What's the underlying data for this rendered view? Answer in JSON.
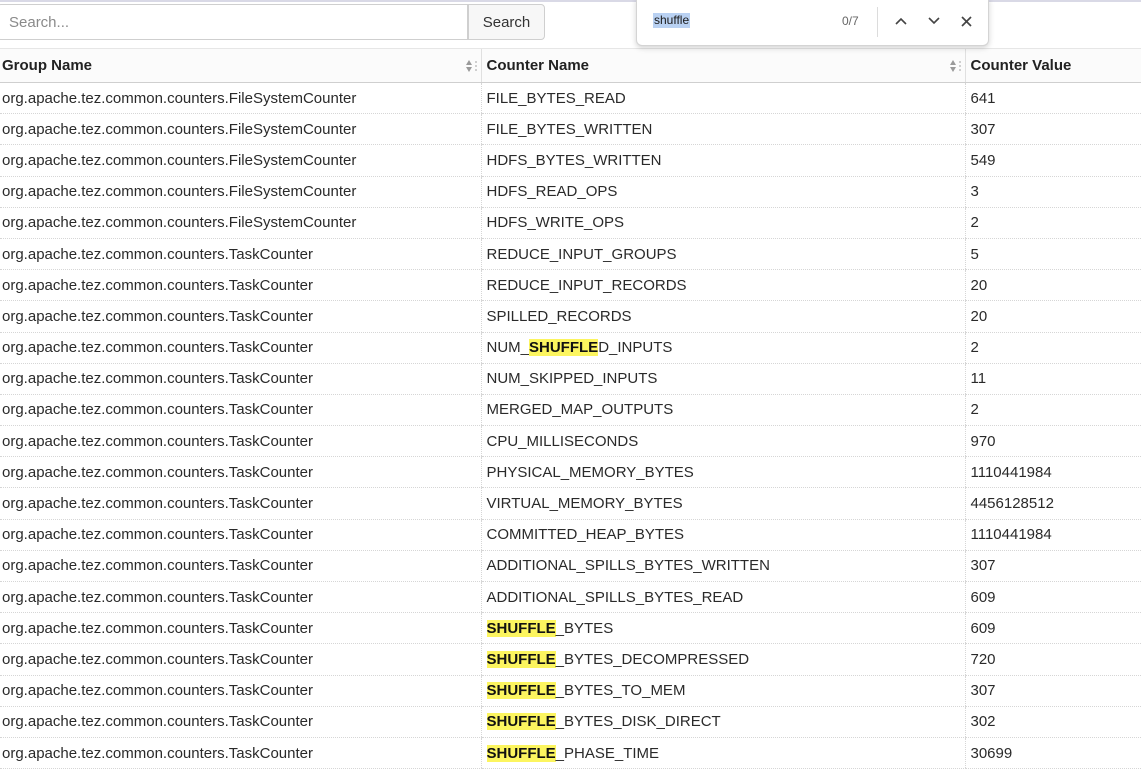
{
  "search": {
    "placeholder": "Search...",
    "value": "",
    "button_label": "Search"
  },
  "find_bar": {
    "query": "shuffle",
    "match_count": "0/7",
    "icons": [
      "chevron-up-icon",
      "chevron-down-icon",
      "close-icon"
    ]
  },
  "table": {
    "columns": [
      {
        "label": "Group Name",
        "sortable": true
      },
      {
        "label": "Counter Name",
        "sortable": true
      },
      {
        "label": "Counter Value",
        "sortable": false
      }
    ],
    "highlight_color": "#fcf55f",
    "rows": [
      {
        "group": "org.apache.tez.common.counters.FileSystemCounter",
        "name": "FILE_BYTES_READ",
        "value": "641"
      },
      {
        "group": "org.apache.tez.common.counters.FileSystemCounter",
        "name": "FILE_BYTES_WRITTEN",
        "value": "307"
      },
      {
        "group": "org.apache.tez.common.counters.FileSystemCounter",
        "name": "HDFS_BYTES_WRITTEN",
        "value": "549"
      },
      {
        "group": "org.apache.tez.common.counters.FileSystemCounter",
        "name": "HDFS_READ_OPS",
        "value": "3"
      },
      {
        "group": "org.apache.tez.common.counters.FileSystemCounter",
        "name": "HDFS_WRITE_OPS",
        "value": "2"
      },
      {
        "group": "org.apache.tez.common.counters.TaskCounter",
        "name": "REDUCE_INPUT_GROUPS",
        "value": "5"
      },
      {
        "group": "org.apache.tez.common.counters.TaskCounter",
        "name": "REDUCE_INPUT_RECORDS",
        "value": "20"
      },
      {
        "group": "org.apache.tez.common.counters.TaskCounter",
        "name": "SPILLED_RECORDS",
        "value": "20"
      },
      {
        "group": "org.apache.tez.common.counters.TaskCounter",
        "name": "NUM_SHUFFLED_INPUTS",
        "value": "2",
        "name_parts": [
          "NUM_",
          "SHUFFLE",
          "D_INPUTS"
        ]
      },
      {
        "group": "org.apache.tez.common.counters.TaskCounter",
        "name": "NUM_SKIPPED_INPUTS",
        "value": "11"
      },
      {
        "group": "org.apache.tez.common.counters.TaskCounter",
        "name": "MERGED_MAP_OUTPUTS",
        "value": "2"
      },
      {
        "group": "org.apache.tez.common.counters.TaskCounter",
        "name": "CPU_MILLISECONDS",
        "value": "970"
      },
      {
        "group": "org.apache.tez.common.counters.TaskCounter",
        "name": "PHYSICAL_MEMORY_BYTES",
        "value": "1110441984"
      },
      {
        "group": "org.apache.tez.common.counters.TaskCounter",
        "name": "VIRTUAL_MEMORY_BYTES",
        "value": "4456128512"
      },
      {
        "group": "org.apache.tez.common.counters.TaskCounter",
        "name": "COMMITTED_HEAP_BYTES",
        "value": "1110441984"
      },
      {
        "group": "org.apache.tez.common.counters.TaskCounter",
        "name": "ADDITIONAL_SPILLS_BYTES_WRITTEN",
        "value": "307"
      },
      {
        "group": "org.apache.tez.common.counters.TaskCounter",
        "name": "ADDITIONAL_SPILLS_BYTES_READ",
        "value": "609"
      },
      {
        "group": "org.apache.tez.common.counters.TaskCounter",
        "name": "SHUFFLE_BYTES",
        "value": "609",
        "name_parts": [
          "",
          "SHUFFLE",
          "_BYTES"
        ]
      },
      {
        "group": "org.apache.tez.common.counters.TaskCounter",
        "name": "SHUFFLE_BYTES_DECOMPRESSED",
        "value": "720",
        "name_parts": [
          "",
          "SHUFFLE",
          "_BYTES_DECOMPRESSED"
        ]
      },
      {
        "group": "org.apache.tez.common.counters.TaskCounter",
        "name": "SHUFFLE_BYTES_TO_MEM",
        "value": "307",
        "name_parts": [
          "",
          "SHUFFLE",
          "_BYTES_TO_MEM"
        ]
      },
      {
        "group": "org.apache.tez.common.counters.TaskCounter",
        "name": "SHUFFLE_BYTES_DISK_DIRECT",
        "value": "302",
        "name_parts": [
          "",
          "SHUFFLE",
          "_BYTES_DISK_DIRECT"
        ]
      },
      {
        "group": "org.apache.tez.common.counters.TaskCounter",
        "name": "SHUFFLE_PHASE_TIME",
        "value": "30699",
        "name_parts": [
          "",
          "SHUFFLE",
          "_PHASE_TIME"
        ]
      }
    ]
  }
}
